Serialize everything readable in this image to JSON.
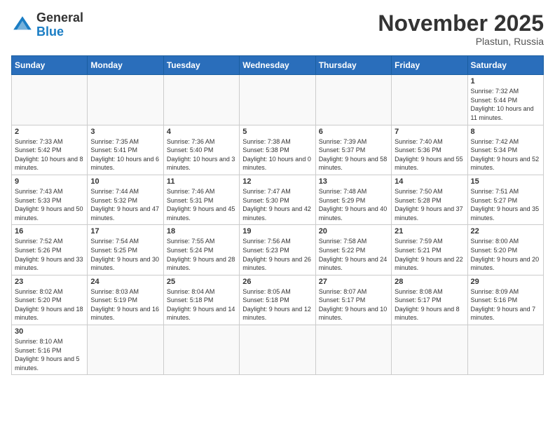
{
  "header": {
    "logo_general": "General",
    "logo_blue": "Blue",
    "month": "November 2025",
    "location": "Plastun, Russia"
  },
  "weekdays": [
    "Sunday",
    "Monday",
    "Tuesday",
    "Wednesday",
    "Thursday",
    "Friday",
    "Saturday"
  ],
  "weeks": [
    [
      {
        "day": "",
        "info": ""
      },
      {
        "day": "",
        "info": ""
      },
      {
        "day": "",
        "info": ""
      },
      {
        "day": "",
        "info": ""
      },
      {
        "day": "",
        "info": ""
      },
      {
        "day": "",
        "info": ""
      },
      {
        "day": "1",
        "info": "Sunrise: 7:32 AM\nSunset: 5:44 PM\nDaylight: 10 hours\nand 11 minutes."
      }
    ],
    [
      {
        "day": "2",
        "info": "Sunrise: 7:33 AM\nSunset: 5:42 PM\nDaylight: 10 hours\nand 8 minutes."
      },
      {
        "day": "3",
        "info": "Sunrise: 7:35 AM\nSunset: 5:41 PM\nDaylight: 10 hours\nand 6 minutes."
      },
      {
        "day": "4",
        "info": "Sunrise: 7:36 AM\nSunset: 5:40 PM\nDaylight: 10 hours\nand 3 minutes."
      },
      {
        "day": "5",
        "info": "Sunrise: 7:38 AM\nSunset: 5:38 PM\nDaylight: 10 hours\nand 0 minutes."
      },
      {
        "day": "6",
        "info": "Sunrise: 7:39 AM\nSunset: 5:37 PM\nDaylight: 9 hours\nand 58 minutes."
      },
      {
        "day": "7",
        "info": "Sunrise: 7:40 AM\nSunset: 5:36 PM\nDaylight: 9 hours\nand 55 minutes."
      },
      {
        "day": "8",
        "info": "Sunrise: 7:42 AM\nSunset: 5:34 PM\nDaylight: 9 hours\nand 52 minutes."
      }
    ],
    [
      {
        "day": "9",
        "info": "Sunrise: 7:43 AM\nSunset: 5:33 PM\nDaylight: 9 hours\nand 50 minutes."
      },
      {
        "day": "10",
        "info": "Sunrise: 7:44 AM\nSunset: 5:32 PM\nDaylight: 9 hours\nand 47 minutes."
      },
      {
        "day": "11",
        "info": "Sunrise: 7:46 AM\nSunset: 5:31 PM\nDaylight: 9 hours\nand 45 minutes."
      },
      {
        "day": "12",
        "info": "Sunrise: 7:47 AM\nSunset: 5:30 PM\nDaylight: 9 hours\nand 42 minutes."
      },
      {
        "day": "13",
        "info": "Sunrise: 7:48 AM\nSunset: 5:29 PM\nDaylight: 9 hours\nand 40 minutes."
      },
      {
        "day": "14",
        "info": "Sunrise: 7:50 AM\nSunset: 5:28 PM\nDaylight: 9 hours\nand 37 minutes."
      },
      {
        "day": "15",
        "info": "Sunrise: 7:51 AM\nSunset: 5:27 PM\nDaylight: 9 hours\nand 35 minutes."
      }
    ],
    [
      {
        "day": "16",
        "info": "Sunrise: 7:52 AM\nSunset: 5:26 PM\nDaylight: 9 hours\nand 33 minutes."
      },
      {
        "day": "17",
        "info": "Sunrise: 7:54 AM\nSunset: 5:25 PM\nDaylight: 9 hours\nand 30 minutes."
      },
      {
        "day": "18",
        "info": "Sunrise: 7:55 AM\nSunset: 5:24 PM\nDaylight: 9 hours\nand 28 minutes."
      },
      {
        "day": "19",
        "info": "Sunrise: 7:56 AM\nSunset: 5:23 PM\nDaylight: 9 hours\nand 26 minutes."
      },
      {
        "day": "20",
        "info": "Sunrise: 7:58 AM\nSunset: 5:22 PM\nDaylight: 9 hours\nand 24 minutes."
      },
      {
        "day": "21",
        "info": "Sunrise: 7:59 AM\nSunset: 5:21 PM\nDaylight: 9 hours\nand 22 minutes."
      },
      {
        "day": "22",
        "info": "Sunrise: 8:00 AM\nSunset: 5:20 PM\nDaylight: 9 hours\nand 20 minutes."
      }
    ],
    [
      {
        "day": "23",
        "info": "Sunrise: 8:02 AM\nSunset: 5:20 PM\nDaylight: 9 hours\nand 18 minutes."
      },
      {
        "day": "24",
        "info": "Sunrise: 8:03 AM\nSunset: 5:19 PM\nDaylight: 9 hours\nand 16 minutes."
      },
      {
        "day": "25",
        "info": "Sunrise: 8:04 AM\nSunset: 5:18 PM\nDaylight: 9 hours\nand 14 minutes."
      },
      {
        "day": "26",
        "info": "Sunrise: 8:05 AM\nSunset: 5:18 PM\nDaylight: 9 hours\nand 12 minutes."
      },
      {
        "day": "27",
        "info": "Sunrise: 8:07 AM\nSunset: 5:17 PM\nDaylight: 9 hours\nand 10 minutes."
      },
      {
        "day": "28",
        "info": "Sunrise: 8:08 AM\nSunset: 5:17 PM\nDaylight: 9 hours\nand 8 minutes."
      },
      {
        "day": "29",
        "info": "Sunrise: 8:09 AM\nSunset: 5:16 PM\nDaylight: 9 hours\nand 7 minutes."
      }
    ],
    [
      {
        "day": "30",
        "info": "Sunrise: 8:10 AM\nSunset: 5:16 PM\nDaylight: 9 hours\nand 5 minutes."
      },
      {
        "day": "",
        "info": ""
      },
      {
        "day": "",
        "info": ""
      },
      {
        "day": "",
        "info": ""
      },
      {
        "day": "",
        "info": ""
      },
      {
        "day": "",
        "info": ""
      },
      {
        "day": "",
        "info": ""
      }
    ]
  ]
}
